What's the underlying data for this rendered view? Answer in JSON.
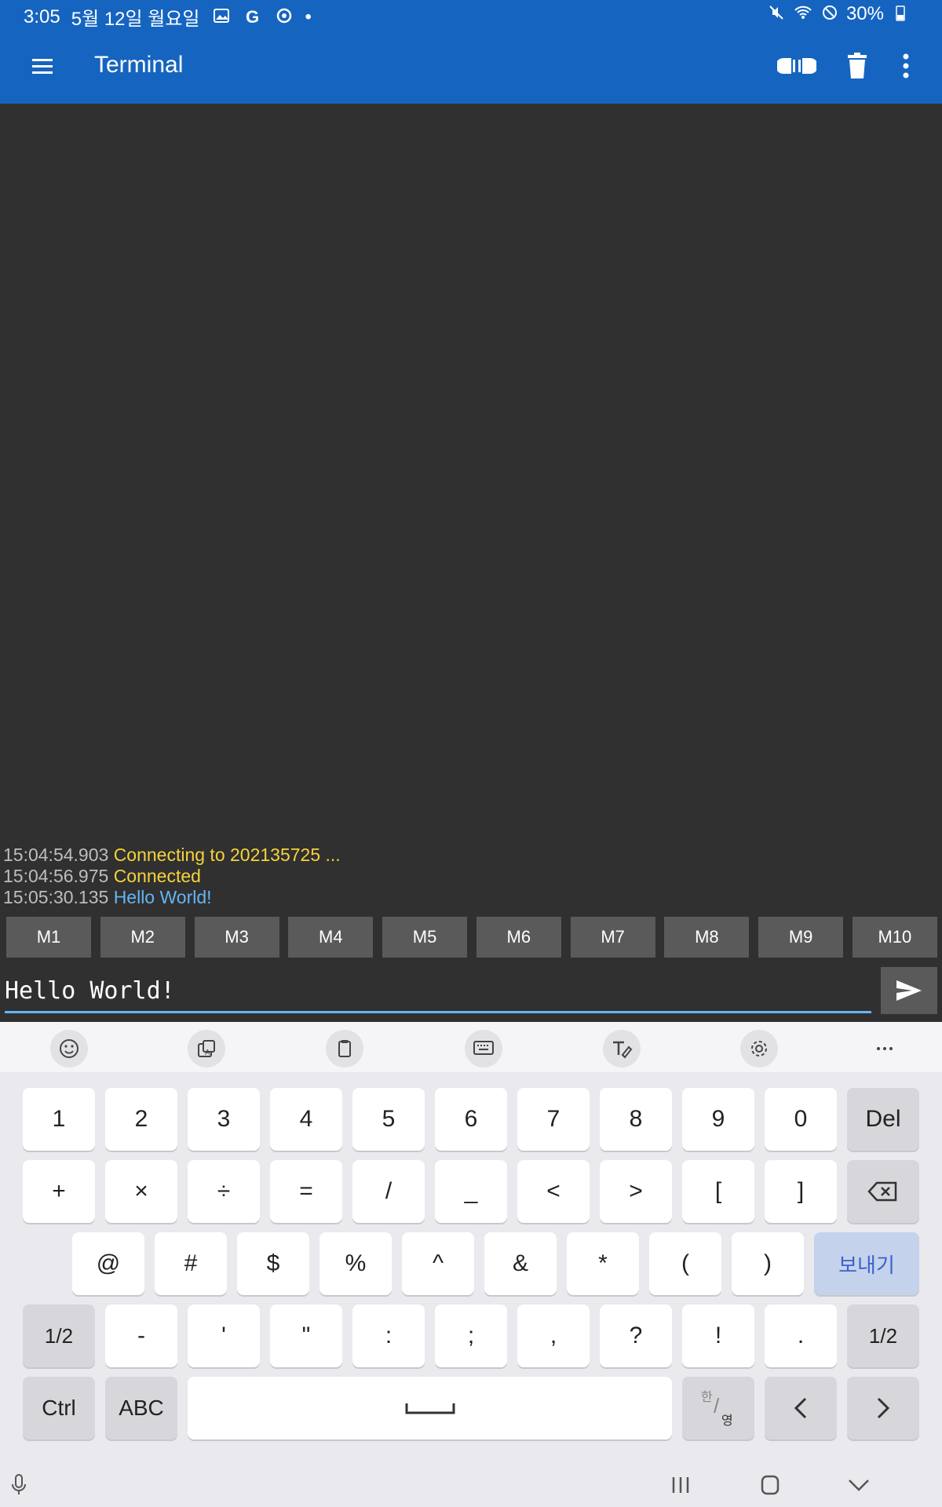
{
  "status_bar": {
    "time": "3:05",
    "date": "5월 12일 월요일",
    "battery": "30%"
  },
  "app_bar": {
    "title": "Terminal",
    "icons": [
      "menu-icon",
      "connect-icon",
      "delete-icon",
      "more-icon"
    ]
  },
  "log": [
    {
      "timestamp": "15:04:54.903",
      "message": "Connecting to 202135725 ...",
      "color": "#f5d33b"
    },
    {
      "timestamp": "15:04:56.975",
      "message": "Connected",
      "color": "#f5d33b"
    },
    {
      "timestamp": "15:05:30.135",
      "message": "Hello World!",
      "color": "#64b5f6"
    }
  ],
  "macros": [
    "M1",
    "M2",
    "M3",
    "M4",
    "M5",
    "M6",
    "M7",
    "M8",
    "M9",
    "M10"
  ],
  "input": {
    "value": "Hello World!"
  },
  "keyboard": {
    "toolbar_icons": [
      "emoji-icon",
      "translate-icon",
      "clipboard-icon",
      "keyboard-layout-icon",
      "handwriting-icon",
      "settings-icon",
      "more-icon"
    ],
    "row1": [
      "1",
      "2",
      "3",
      "4",
      "5",
      "6",
      "7",
      "8",
      "9",
      "0",
      "Del"
    ],
    "row2": [
      "+",
      "×",
      "÷",
      "=",
      "/",
      "_",
      "<",
      ">",
      "[",
      "]"
    ],
    "row3": [
      "@",
      "#",
      "$",
      "%",
      "^",
      "&",
      "*",
      "(",
      ")",
      "보내기"
    ],
    "row4": [
      "1/2",
      "-",
      "'",
      "\"",
      ":",
      ";",
      ",",
      "?",
      "!",
      ".",
      "1/2"
    ],
    "row5": [
      "Ctrl",
      "ABC"
    ],
    "hangul_top": "한",
    "hangul_bottom": "영"
  }
}
